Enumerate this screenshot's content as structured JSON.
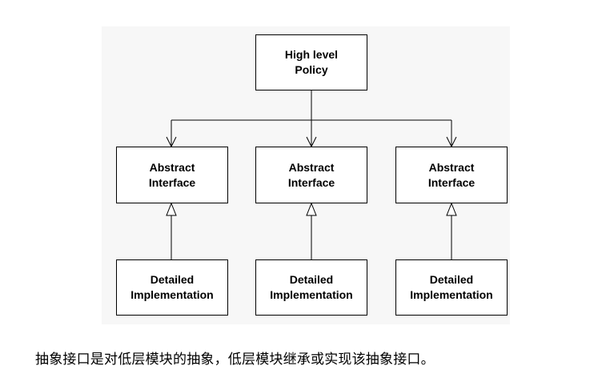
{
  "diagram": {
    "policy": {
      "label": "High level\nPolicy"
    },
    "interfaces": [
      {
        "label": "Abstract\nInterface"
      },
      {
        "label": "Abstract\nInterface"
      },
      {
        "label": "Abstract\nInterface"
      }
    ],
    "implementations": [
      {
        "label": "Detailed\nImplementation"
      },
      {
        "label": "Detailed\nImplementation"
      },
      {
        "label": "Detailed\nImplementation"
      }
    ],
    "edges": [
      {
        "from": "policy",
        "to": "interface-1",
        "style": "uses-arrow"
      },
      {
        "from": "policy",
        "to": "interface-2",
        "style": "uses-arrow"
      },
      {
        "from": "policy",
        "to": "interface-3",
        "style": "uses-arrow"
      },
      {
        "from": "implementation-1",
        "to": "interface-1",
        "style": "realization"
      },
      {
        "from": "implementation-2",
        "to": "interface-2",
        "style": "realization"
      },
      {
        "from": "implementation-3",
        "to": "interface-3",
        "style": "realization"
      }
    ]
  },
  "caption": "抽象接口是对低层模块的抽象，低层模块继承或实现该抽象接口。",
  "colors": {
    "panel_background": "#f7f7f7",
    "box_background": "#ffffff",
    "line": "#000000"
  }
}
